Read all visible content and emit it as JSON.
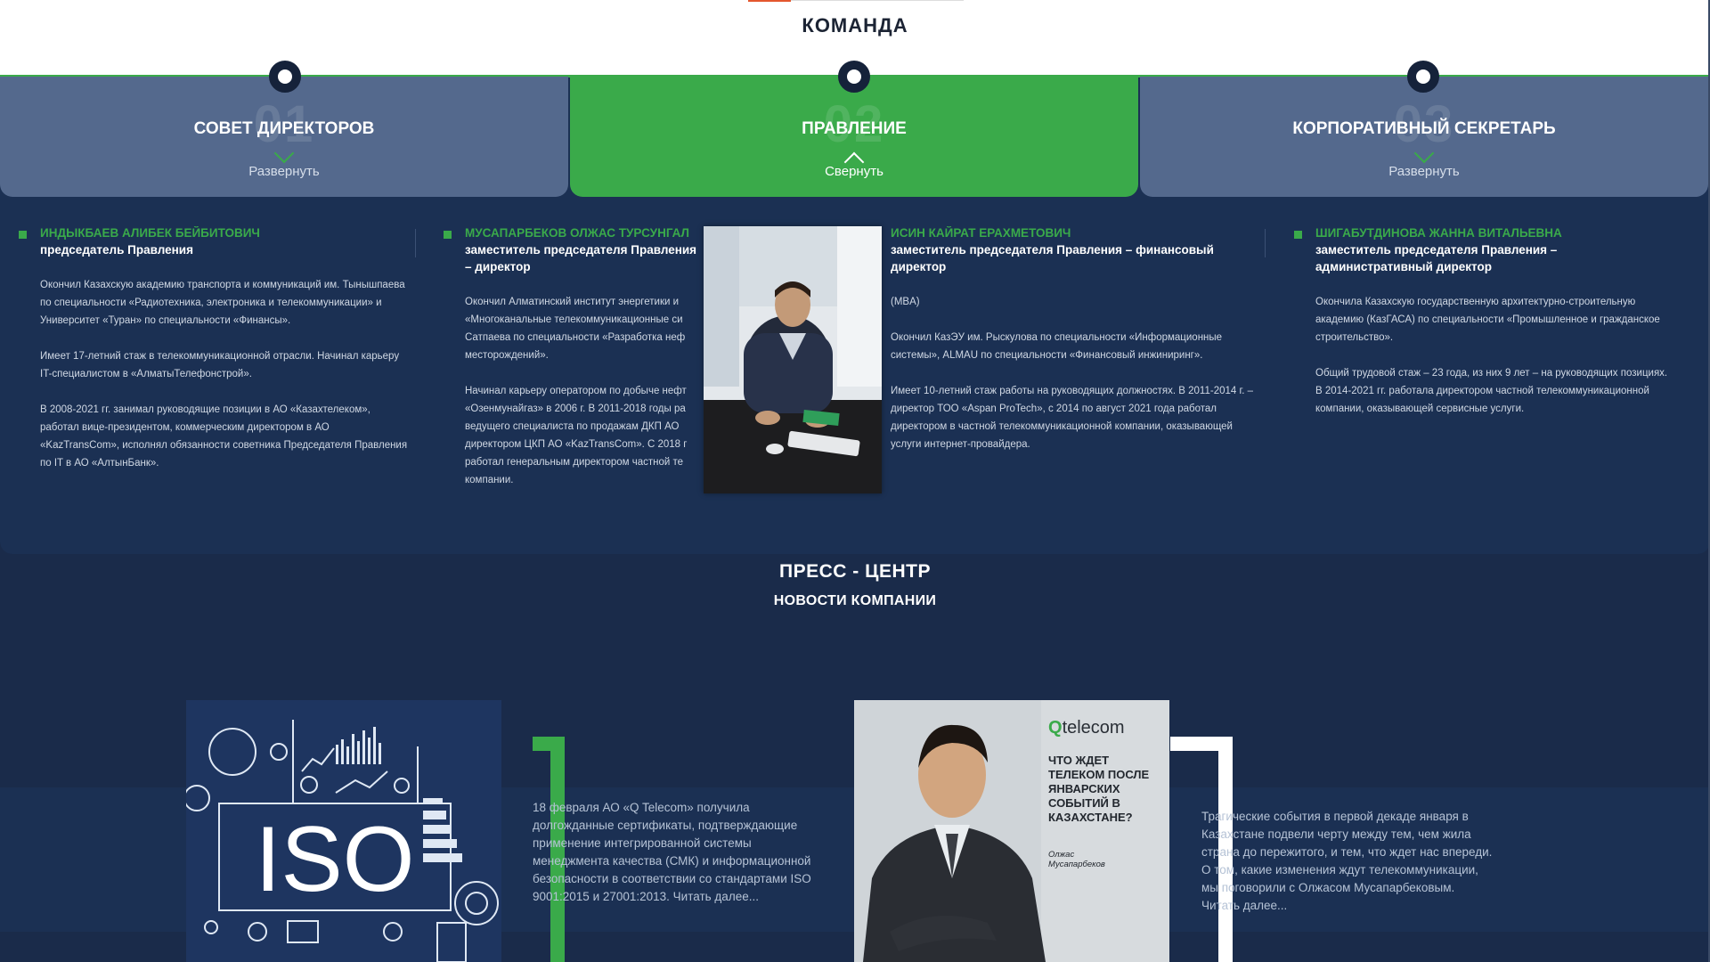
{
  "header": {
    "title": "КОМАНДА"
  },
  "tabs": [
    {
      "num": "01",
      "title": "СОВЕТ ДИРЕКТОРОВ",
      "toggle": "Развернуть",
      "active": false
    },
    {
      "num": "02",
      "title": "ПРАВЛЕНИЕ",
      "toggle": "Свернуть",
      "active": true
    },
    {
      "num": "03",
      "title": "КОРПОРАТИВНЫЙ СЕКРЕТАРЬ",
      "toggle": "Развернуть",
      "active": false
    }
  ],
  "members": [
    {
      "name": "ИНДЫКБАЕВ АЛИБЕК БЕЙБИТОВИЧ",
      "role": "председатель Правления",
      "bio": [
        "Окончил Казахскую академию транспорта и коммуникаций им. Тынышпаева по специальности «Радиотехника, электроника и телекоммуникации» и Университет «Туран» по специальности «Финансы».",
        "Имеет 17-летний стаж в телекоммуникационной отрасли. Начинал карьеру IT-специалистом в «АлматыТелефонстрой».",
        "В 2008-2021 гг. занимал руководящие позиции в АО «Казахтелеком», работал вице-президентом, коммерческим директором в АО «KazTransCom», исполнял обязанности советника Председателя Правления по IT в АО «АлтынБанк»."
      ]
    },
    {
      "name": "МУСАПАРБЕКОВ ОЛЖАС ТУРСУНГАЛ",
      "role": "заместитель председателя Правления – директор",
      "bio": [
        "Окончил Алматинский институт энергетики и «Многоканальные телекоммуникационные си Сатпаева по специальности «Разработка неф месторождений».",
        "Начинал карьеру оператором по добыче нефт «Озенмунайгаз» в 2006 г. В 2011-2018 годы ра ведущего специалиста по продажам ДКП АО директором ЦКП АО «KazTransCom». С 2018 г работал генеральным директором частной те компании."
      ]
    },
    {
      "name": "ИСИН КАЙРАТ ЕРАХМЕТОВИЧ",
      "role": "заместитель председателя Правления – финансовый директор",
      "bio": [
        "(MBA)",
        "Окончил КазЭУ им. Рыскулова по специальности «Информационные системы», ALMAU по специальности «Финансовый инжиниринг».",
        "Имеет 10-летний стаж работы на руководящих должностях. В 2011-2014 г. – директор ТОО «Aspan ProTech», с 2014 по август 2021 года работал директором в частной телекоммуникационной компании, оказывающей услуги интернет-провайдера."
      ]
    },
    {
      "name": "ШИГАБУТДИНОВА ЖАННА ВИТАЛЬЕВНА",
      "role": "заместитель председателя Правления – административный директор",
      "bio": [
        "Окончила Казахскую государственную архитектурно-строительную академию (КазГАСА) по специальности «Промышленное и гражданское строительство».",
        "Общий трудовой стаж – 23 года, из них 9 лет – на руководящих позициях. В 2014-2021 гг. работала директором частной телекоммуникационной компании, оказывающей сервисные услуги."
      ]
    }
  ],
  "press": {
    "title": "ПРЕСС - ЦЕНТР",
    "subtitle": "НОВОСТИ КОМПАНИИ",
    "news": [
      {
        "image_text": "ISO",
        "text": "18 февраля АО «Q Telecom» получила долгожданные сертификаты, подтверждающие применение интегрированной системы менеджмента качества (СМК) и информационной безопасности в соответствии со стандартами ISO 9001:2015 и 27001:2013. Читать далее..."
      },
      {
        "image_logo": "telecom",
        "image_heading": "ЧТО ЖДЕТ ТЕЛЕКОМ ПОСЛЕ ЯНВАРСКИХ СОБЫТИЙ В КАЗАХСТАНЕ?",
        "image_author": "Олжас Мусапарбеков",
        "text": "Трагические события в первой декаде января в Казахстане подвели черту между тем, чем жила страна до пережитого, и тем, что ждет нас впереди. О том, какие изменения ждут телекоммуникации, мы поговорили с Олжасом Мусапарбековым. Читать далее..."
      }
    ]
  },
  "colors": {
    "green": "#3aaa4a",
    "navy": "#1b3053",
    "tab": "#54698d"
  }
}
